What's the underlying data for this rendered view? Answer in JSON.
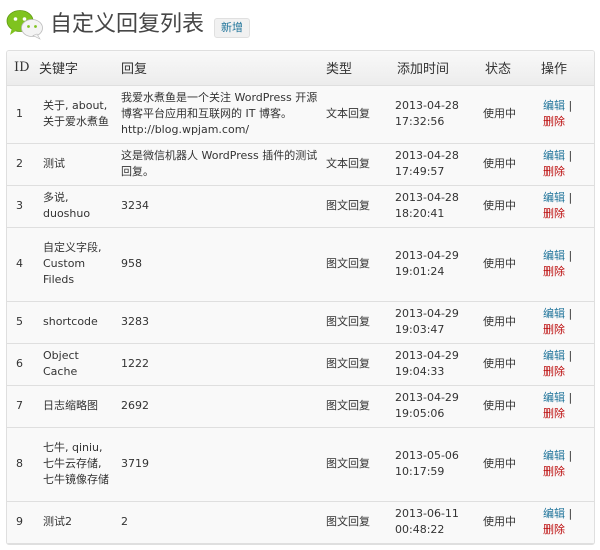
{
  "header": {
    "title": "自定义回复列表",
    "add_new_label": "新增"
  },
  "columns": {
    "id": "ID",
    "keyword": "关键字",
    "reply": "回复",
    "type": "类型",
    "added_time": "添加时间",
    "status": "状态",
    "actions": "操作"
  },
  "action_labels": {
    "edit": "编辑",
    "separator": "|",
    "delete": "删除"
  },
  "rows": [
    {
      "id": "1",
      "keyword": "关于, about, 关于爱水煮鱼",
      "reply": "我爱水煮鱼是一个关注 WordPress 开源博客平台应用和互联网的 IT 博客。http://blog.wpjam.com/",
      "type": "文本回复",
      "date": "2013-04-28",
      "time": "17:32:56",
      "status": "使用中"
    },
    {
      "id": "2",
      "keyword": "测试",
      "reply": "这是微信机器人 WordPress 插件的测试回复。",
      "type": "文本回复",
      "date": "2013-04-28",
      "time": "17:49:57",
      "status": "使用中"
    },
    {
      "id": "3",
      "keyword": "多说, duoshuo",
      "reply": "3234",
      "type": "图文回复",
      "date": "2013-04-28",
      "time": "18:20:41",
      "status": "使用中"
    },
    {
      "id": "4",
      "keyword": "自定义字段, Custom Fileds",
      "reply": "958",
      "type": "图文回复",
      "date": "2013-04-29",
      "time": "19:01:24",
      "status": "使用中"
    },
    {
      "id": "5",
      "keyword": "shortcode",
      "reply": "3283",
      "type": "图文回复",
      "date": "2013-04-29",
      "time": "19:03:47",
      "status": "使用中"
    },
    {
      "id": "6",
      "keyword": "Object Cache",
      "reply": "1222",
      "type": "图文回复",
      "date": "2013-04-29",
      "time": "19:04:33",
      "status": "使用中"
    },
    {
      "id": "7",
      "keyword": "日志缩略图",
      "reply": "2692",
      "type": "图文回复",
      "date": "2013-04-29",
      "time": "19:05:06",
      "status": "使用中"
    },
    {
      "id": "8",
      "keyword": "七牛, qiniu, 七牛云存储, 七牛镜像存储",
      "reply": "3719",
      "type": "图文回复",
      "date": "2013-05-06",
      "time": "10:17:59",
      "status": "使用中"
    },
    {
      "id": "9",
      "keyword": "测试2",
      "reply": "2",
      "type": "图文回复",
      "date": "2013-06-11",
      "time": "00:48:22",
      "status": "使用中"
    }
  ],
  "colors": {
    "link": "#21759b",
    "delete": "#bc0b0b",
    "logo_green": "#7fc31f"
  }
}
